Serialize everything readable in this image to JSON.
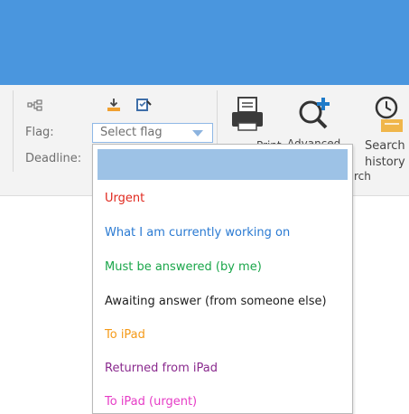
{
  "ribbon": {
    "flag_label": "Flag:",
    "deadline_label": "Deadline:",
    "flag_select_value": "Select flag",
    "print_label": "Print",
    "advanced_label": "Advanced",
    "advanced_suffix": "rch",
    "search_history_line1": "Search",
    "search_history_line2": "history"
  },
  "dropdown": {
    "items": [
      {
        "label": "",
        "color": "#9dc2e6"
      },
      {
        "label": "Urgent",
        "color": "#e0281e"
      },
      {
        "label": "What I am currently working on",
        "color": "#2a7ad2"
      },
      {
        "label": "Must be answered (by me)",
        "color": "#1aa64a"
      },
      {
        "label": "Awaiting answer (from someone else)",
        "color": "#1e1e1e"
      },
      {
        "label": "To iPad",
        "color": "#f59a18"
      },
      {
        "label": "Returned from iPad",
        "color": "#8a2a8e"
      },
      {
        "label": "To iPad (urgent)",
        "color": "#e63cc6"
      }
    ]
  },
  "colors": {
    "title_bar": "#4a96de",
    "ribbon_bg": "#f3f3f3",
    "selection": "#9dc2e6"
  }
}
